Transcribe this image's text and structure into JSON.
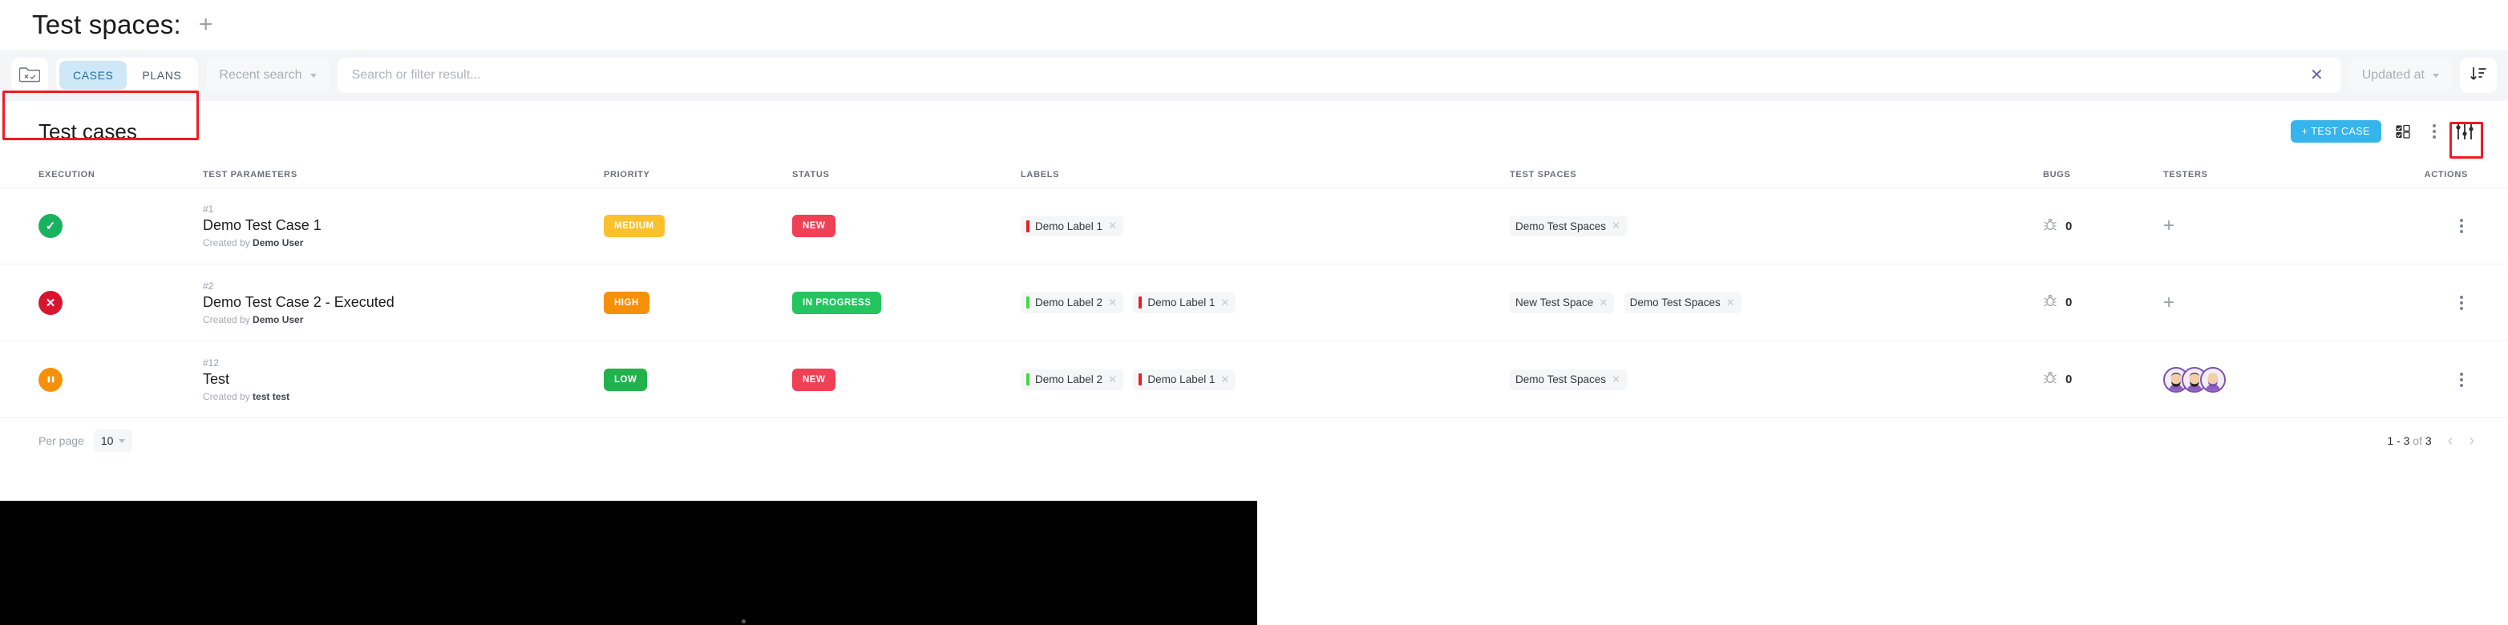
{
  "header": {
    "page_title": "Test spaces:",
    "add_icon": "plus-icon"
  },
  "toolbar": {
    "folder_icon": "folder-test-icon",
    "tabs": [
      {
        "label": "CASES",
        "active": true
      },
      {
        "label": "PLANS",
        "active": false
      }
    ],
    "recent_search": {
      "label": "Recent search",
      "chevron": "chevron-down-icon"
    },
    "search": {
      "value": "",
      "placeholder": "Search or filter result...",
      "clear_icon": "close-icon"
    },
    "sort_field": {
      "label": "Updated at",
      "chevron": "chevron-down-icon"
    },
    "sort_direction_icon": "sort-descending-icon"
  },
  "content": {
    "title": "Test cases",
    "add_button": "+ TEST CASE",
    "view_toggle_icon": "checkbox-grid-icon",
    "more_icon": "vertical-dots-icon",
    "settings_icon": "sliders-icon"
  },
  "table": {
    "columns": [
      "EXECUTION",
      "TEST PARAMETERS",
      "PRIORITY",
      "STATUS",
      "LABELS",
      "TEST SPACES",
      "BUGS",
      "TESTERS",
      "ACTIONS"
    ],
    "rows": [
      {
        "execution": {
          "icon": "check-icon",
          "state": "passed",
          "color": "#19b35f",
          "glyph": "✔"
        },
        "id": "#1",
        "name": "Demo Test Case 1",
        "created_by_prefix": "Created by",
        "created_by": "Demo User",
        "priority": {
          "label": "MEDIUM",
          "color": "#fbc02d"
        },
        "status": {
          "label": "NEW",
          "color": "#ef4056"
        },
        "labels": [
          {
            "text": "Demo Label 1",
            "color": "#ee1c24"
          }
        ],
        "spaces": [
          "Demo Test Spaces"
        ],
        "bugs": "0",
        "testers": {
          "type": "add",
          "icon": "plus-icon",
          "avatars": []
        },
        "actions_icon": "vertical-dots-icon"
      },
      {
        "execution": {
          "icon": "close-icon",
          "state": "failed",
          "color": "#d8152f",
          "glyph": "✖"
        },
        "id": "#2",
        "name": "Demo Test Case 2 - Executed",
        "created_by_prefix": "Created by",
        "created_by": "Demo User",
        "priority": {
          "label": "HIGH",
          "color": "#f79009"
        },
        "status": {
          "label": "IN PROGRESS",
          "color": "#24c55e"
        },
        "labels": [
          {
            "text": "Demo Label 2",
            "color": "#3ddb3d"
          },
          {
            "text": "Demo Label 1",
            "color": "#ee1c24"
          }
        ],
        "spaces": [
          "New Test Space",
          "Demo Test Spaces"
        ],
        "bugs": "0",
        "testers": {
          "type": "add",
          "icon": "plus-icon",
          "avatars": []
        },
        "actions_icon": "vertical-dots-icon"
      },
      {
        "execution": {
          "icon": "pause-icon",
          "state": "blocked",
          "color": "#f79009",
          "glyph": "❘❘"
        },
        "id": "#12",
        "name": "Test",
        "created_by_prefix": "Created by",
        "created_by": "test test",
        "priority": {
          "label": "LOW",
          "color": "#22b14c"
        },
        "status": {
          "label": "NEW",
          "color": "#ef4056"
        },
        "labels": [
          {
            "text": "Demo Label 2",
            "color": "#3ddb3d"
          },
          {
            "text": "Demo Label 1",
            "color": "#ee1c24"
          }
        ],
        "spaces": [
          "Demo Test Spaces"
        ],
        "bugs": "0",
        "testers": {
          "type": "avatars",
          "icon": "avatar-group",
          "avatars": [
            "avatar-1",
            "avatar-2",
            "avatar-3"
          ]
        },
        "actions_icon": "vertical-dots-icon"
      }
    ]
  },
  "footer": {
    "per_page_label": "Per page",
    "per_page_value": "10",
    "range_start": "1 - 3",
    "range_of": "of",
    "range_total": "3",
    "prev_icon": "chevron-left-icon",
    "next_icon": "chevron-right-icon"
  },
  "colors": {
    "accent": "#35b5eb",
    "highlight": "#ee1b24",
    "toolbar_bg": "#f4f5f7",
    "tab_active_bg": "#cfe8f7"
  }
}
